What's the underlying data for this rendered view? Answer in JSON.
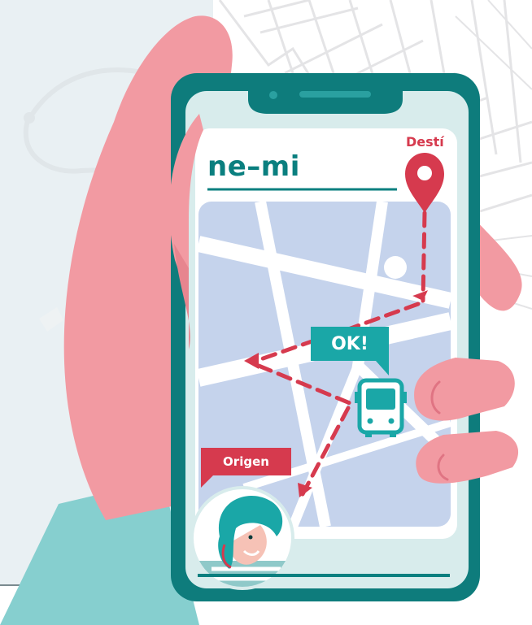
{
  "brand": {
    "wordmark": "ne–mi"
  },
  "map": {
    "destination_label": "Destí",
    "status_bubble": "OK!",
    "origin_label": "Origen"
  },
  "icons": {
    "destination": "map-pin-icon",
    "vehicle": "bus-icon",
    "user": "user-avatar-icon",
    "status": "speech-bubble-icon"
  },
  "colors": {
    "brand_teal": "#0a7f7f",
    "accent_red": "#d63a4e",
    "hand_pink": "#f29aa2",
    "map_blue": "#c5d3ec",
    "screen_light": "#d8ecec",
    "sleeve_teal": "#86cfcf"
  }
}
